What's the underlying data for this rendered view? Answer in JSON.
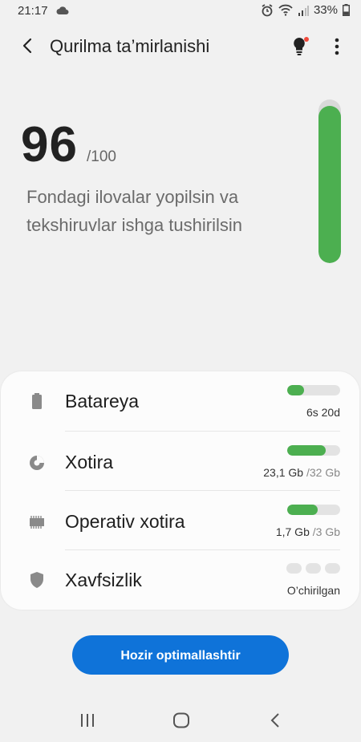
{
  "status_bar": {
    "time": "21:17",
    "battery": "33%"
  },
  "header": {
    "title": "Qurilma ta’mirlanishi"
  },
  "score": {
    "value": "96",
    "max": "/100",
    "level": 0.96,
    "description": "Fondagi ilovalar yopilsin va tekshiruvlar ishga tushirilsin",
    "color": "#4caf50"
  },
  "items": [
    {
      "name": "Batareya",
      "value": "6s 20d",
      "level": 0.32
    },
    {
      "name": "Xotira",
      "value": "23,1 Gb",
      "value_total": " /32 Gb",
      "level": 0.72
    },
    {
      "name": "Operativ xotira",
      "value": "1,7 Gb",
      "value_total": " /3 Gb",
      "level": 0.57
    },
    {
      "name": "Xavfsizlik",
      "value": "O’chirilgan"
    }
  ],
  "button": {
    "label": "Hozir optimallashtir",
    "color": "#0f73d9"
  }
}
